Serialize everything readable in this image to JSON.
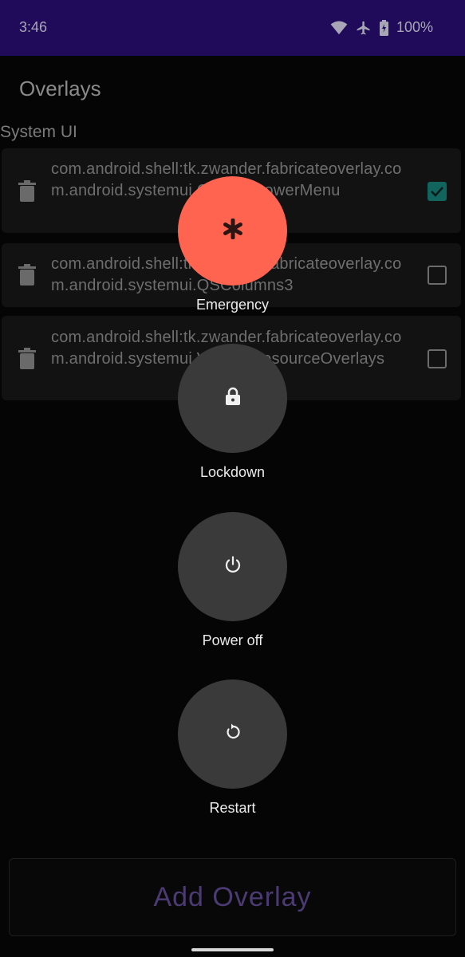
{
  "status_bar": {
    "time": "3:46",
    "battery": "100%",
    "icons": [
      "wifi-icon",
      "airplane-icon",
      "battery-icon"
    ]
  },
  "app": {
    "title": "Overlays"
  },
  "section": {
    "title": "System UI"
  },
  "overlays": [
    {
      "package": "com.android.shell:tk.zwander.fabricateoverlay.com.android.systemui.ChangePowerMenu",
      "enabled": true
    },
    {
      "package": "com.android.shell:tk.zwander.fabricateoverlay.com.android.systemui.QSColumns3",
      "enabled": false
    },
    {
      "package": "com.android.shell:tk.zwander.fabricateoverlay.com.android.systemui.VariousResourceOverlays",
      "enabled": false
    }
  ],
  "power_menu": {
    "emergency": "Emergency",
    "lockdown": "Lockdown",
    "power_off": "Power off",
    "restart": "Restart"
  },
  "add_button": {
    "label": "Add Overlay"
  },
  "colors": {
    "status_bar": "#1f0b5a",
    "emergency": "#ff6451",
    "checkbox": "#12655e",
    "accent_text": "#4c3b73"
  }
}
